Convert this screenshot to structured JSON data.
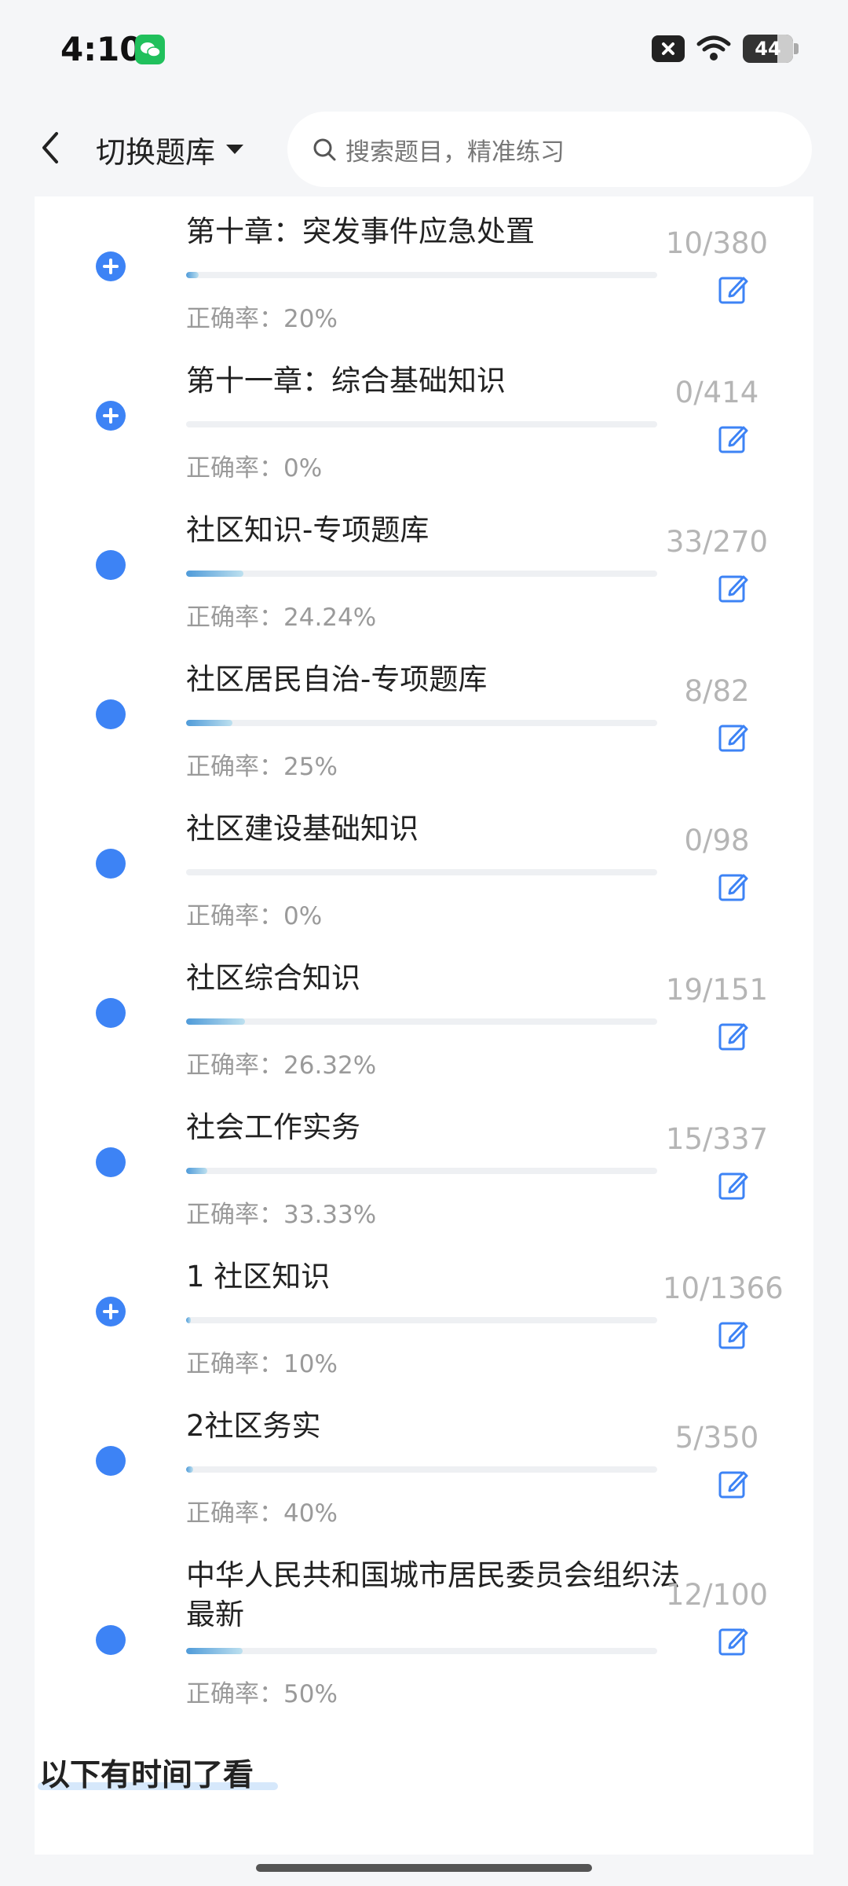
{
  "status": {
    "time": "4:10",
    "battery": "44"
  },
  "nav": {
    "bank_label": "切换题库",
    "search_placeholder": "搜索题目，精准练习"
  },
  "items": [
    {
      "title": "第十章：突发事件应急处置",
      "rate": "正确率：20%",
      "count": "10/380",
      "done": 10,
      "total": 380,
      "icon": "plus-icon"
    },
    {
      "title": "第十一章：综合基础知识",
      "rate": "正确率：0%",
      "count": "0/414",
      "done": 0,
      "total": 414,
      "icon": "plus-icon"
    },
    {
      "title": "社区知识-专项题库",
      "rate": "正确率：24.24%",
      "count": "33/270",
      "done": 33,
      "total": 270,
      "icon": "dot-icon"
    },
    {
      "title": "社区居民自治-专项题库",
      "rate": "正确率：25%",
      "count": "8/82",
      "done": 8,
      "total": 82,
      "icon": "dot-icon"
    },
    {
      "title": "社区建设基础知识",
      "rate": "正确率：0%",
      "count": "0/98",
      "done": 0,
      "total": 98,
      "icon": "dot-icon"
    },
    {
      "title": "社区综合知识",
      "rate": "正确率：26.32%",
      "count": "19/151",
      "done": 19,
      "total": 151,
      "icon": "dot-icon"
    },
    {
      "title": "社会工作实务",
      "rate": "正确率：33.33%",
      "count": "15/337",
      "done": 15,
      "total": 337,
      "icon": "dot-icon"
    },
    {
      "title": "1 社区知识",
      "rate": "正确率：10%",
      "count": "10/1366",
      "done": 10,
      "total": 1366,
      "icon": "plus-icon"
    },
    {
      "title": "2社区务实",
      "rate": "正确率：40%",
      "count": "5/350",
      "done": 5,
      "total": 350,
      "icon": "dot-icon"
    },
    {
      "title": "中华人民共和国城市居民委员会组织法 最新",
      "rate": "正确率：50%",
      "count": "12/100",
      "done": 12,
      "total": 100,
      "icon": "dot-icon"
    }
  ],
  "section_title": "以下有时间了看",
  "colors": {
    "accent": "#3d83f5"
  }
}
